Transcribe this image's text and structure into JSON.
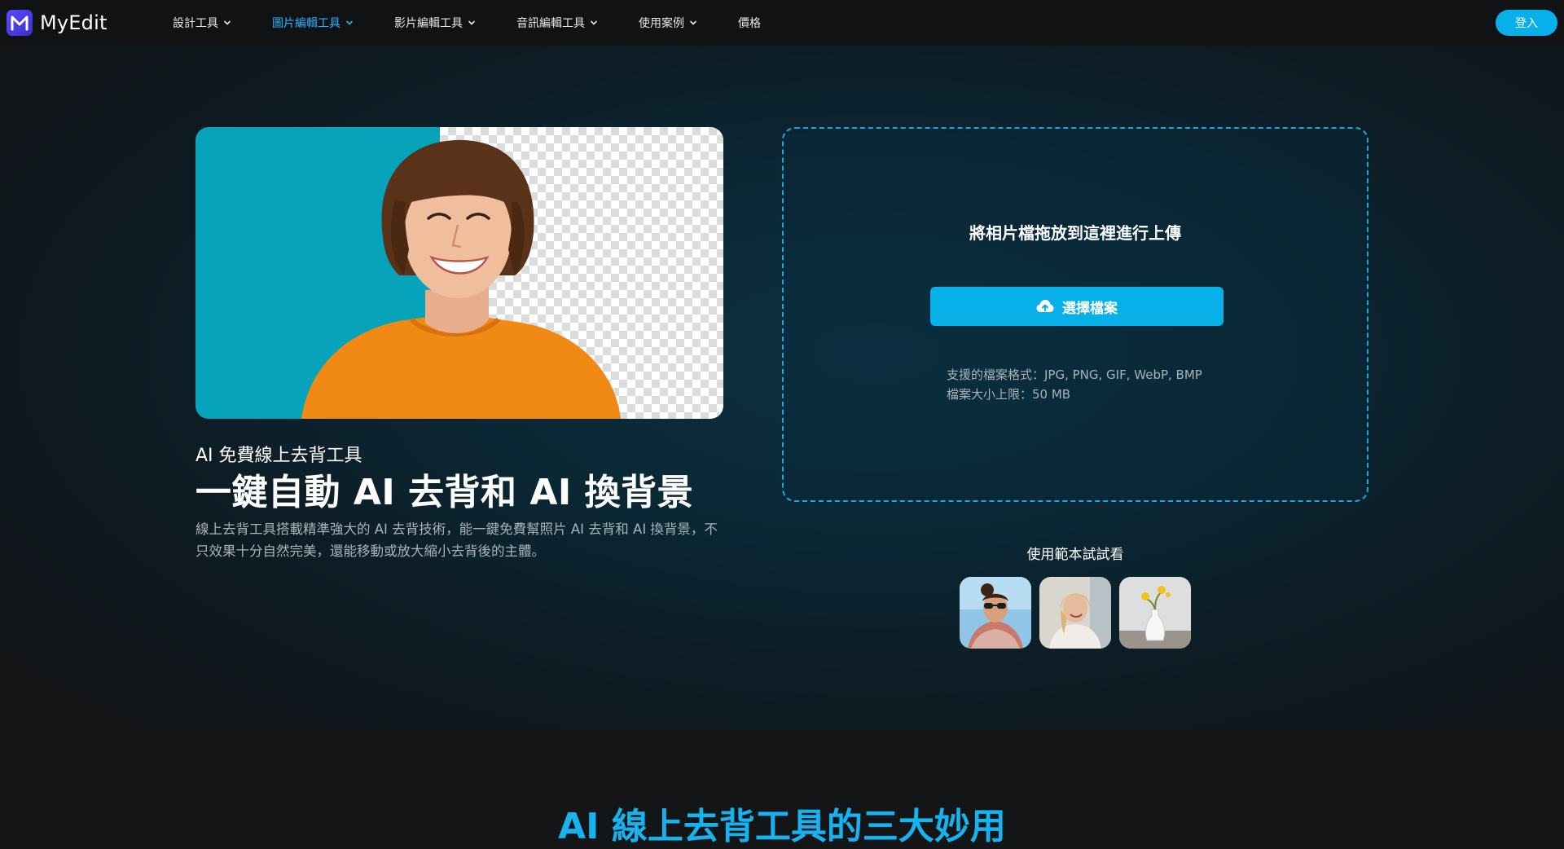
{
  "header": {
    "brand": "MyEdit",
    "nav": [
      {
        "label": "設計工具",
        "active": false
      },
      {
        "label": "圖片編輯工具",
        "active": true
      },
      {
        "label": "影片編輯工具",
        "active": false
      },
      {
        "label": "音訊編輯工具",
        "active": false
      },
      {
        "label": "使用案例",
        "active": false
      }
    ],
    "pricing": "價格",
    "login": "登入"
  },
  "hero": {
    "subtitle": "AI 免費線上去背工具",
    "title": "一鍵自動 AI 去背和 AI 換背景",
    "description": "線上去背工具搭載精準強大的 AI 去背技術，能一鍵免費幫照片 AI 去背和 AI 換背景，不只效果十分自然完美，還能移動或放大縮小去背後的主體。"
  },
  "upload": {
    "drop_text": "將相片檔拖放到這裡進行上傳",
    "button_label": "選擇檔案",
    "formats": "支援的檔案格式：JPG, PNG, GIF, WebP, BMP",
    "size_limit": "檔案大小上限：50 MB"
  },
  "samples": {
    "title": "使用範本試試看",
    "items": [
      "sample-woman-sunglasses",
      "sample-woman-smiling",
      "sample-flower-vase"
    ]
  },
  "section2": {
    "title": "AI 線上去背工具的三大妙用"
  },
  "colors": {
    "accent": "#07b0e9",
    "active_nav": "#2ab4ff",
    "hero_teal": "#06a3bb",
    "shirt_orange": "#f18a14"
  }
}
